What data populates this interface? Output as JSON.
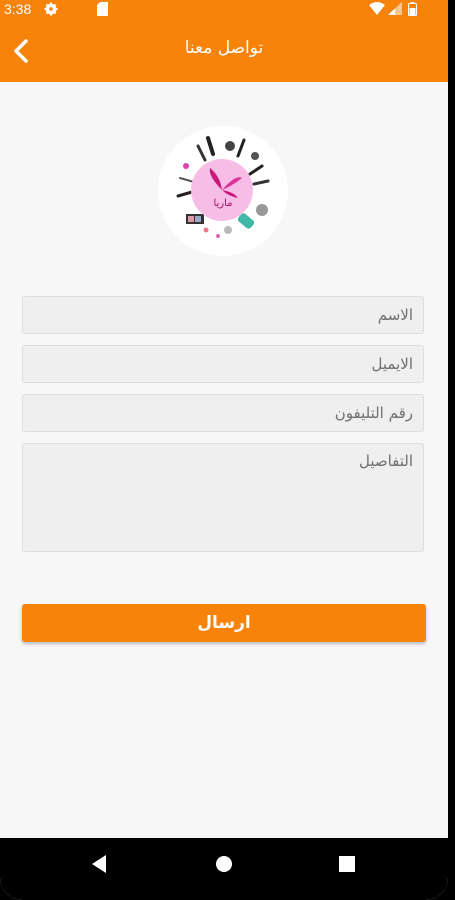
{
  "status_bar": {
    "time": "3:38",
    "icons": [
      "settings-icon",
      "sd-card-icon",
      "wifi-icon",
      "signal-icon",
      "battery-icon"
    ]
  },
  "app_bar": {
    "title": "تواصل معنا",
    "back_icon": "chevron-left-icon",
    "color": "#f7830a"
  },
  "logo": {
    "text": "ماريا",
    "accent_color": "#d6308f"
  },
  "form": {
    "name_placeholder": "الاسم",
    "email_placeholder": "الايميل",
    "phone_placeholder": "رقم التليفون",
    "details_placeholder": "التفاصيل",
    "submit_label": "ارسال"
  },
  "nav_bar": {
    "buttons": [
      "back-triangle-icon",
      "home-circle-icon",
      "recents-square-icon"
    ]
  }
}
